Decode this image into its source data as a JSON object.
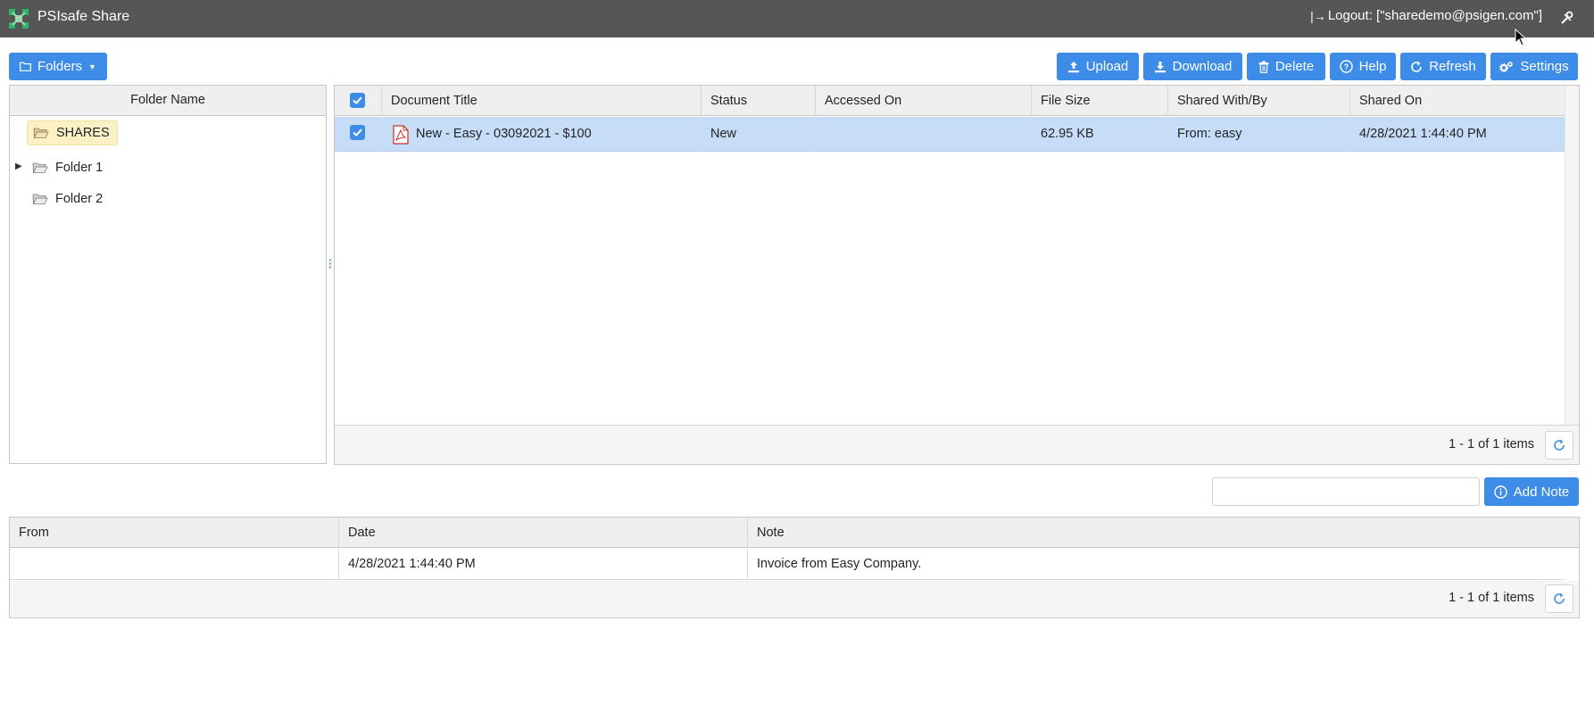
{
  "app": {
    "title": "PSIsafe Share",
    "logout_label": "Logout: [\"sharedemo@psigen.com\"]"
  },
  "toolbar": {
    "folders_label": "Folders",
    "upload_label": "Upload",
    "download_label": "Download",
    "delete_label": "Delete",
    "help_label": "Help",
    "refresh_label": "Refresh",
    "settings_label": "Settings"
  },
  "folders": {
    "header": "Folder Name",
    "items": [
      {
        "label": "SHARES",
        "selected": true,
        "expandable": false
      },
      {
        "label": "Folder 1",
        "selected": false,
        "expandable": true
      },
      {
        "label": "Folder 2",
        "selected": false,
        "expandable": false
      }
    ]
  },
  "documents": {
    "columns": [
      "Document Title",
      "Status",
      "Accessed On",
      "File Size",
      "Shared With/By",
      "Shared On"
    ],
    "rows": [
      {
        "checked": true,
        "title": "New - Easy - 03092021 - $100",
        "status": "New",
        "accessed_on": "",
        "file_size": "62.95 KB",
        "shared_with_by": "From: easy",
        "shared_on": "4/28/2021 1:44:40 PM"
      }
    ],
    "pager_text": "1 - 1 of 1 items"
  },
  "notes": {
    "input_value": "",
    "add_note_label": "Add Note",
    "columns": [
      "From",
      "Date",
      "Note"
    ],
    "rows": [
      {
        "from": "",
        "date": "4/28/2021 1:44:40 PM",
        "note": "Invoice from Easy Company."
      }
    ],
    "pager_text": "1 - 1 of 1 items"
  },
  "colors": {
    "topbar": "#565656",
    "accent": "#3d8de8",
    "selected_row": "#c7dcf7",
    "selected_folder": "#fcf0c5"
  },
  "icons": [
    "app-logo-icon",
    "logout-icon",
    "tools-icon",
    "folder-icon",
    "upload-icon",
    "download-icon",
    "trash-icon",
    "help-icon",
    "refresh-icon",
    "gears-icon",
    "pdf-icon",
    "info-icon",
    "checkbox-icon"
  ]
}
